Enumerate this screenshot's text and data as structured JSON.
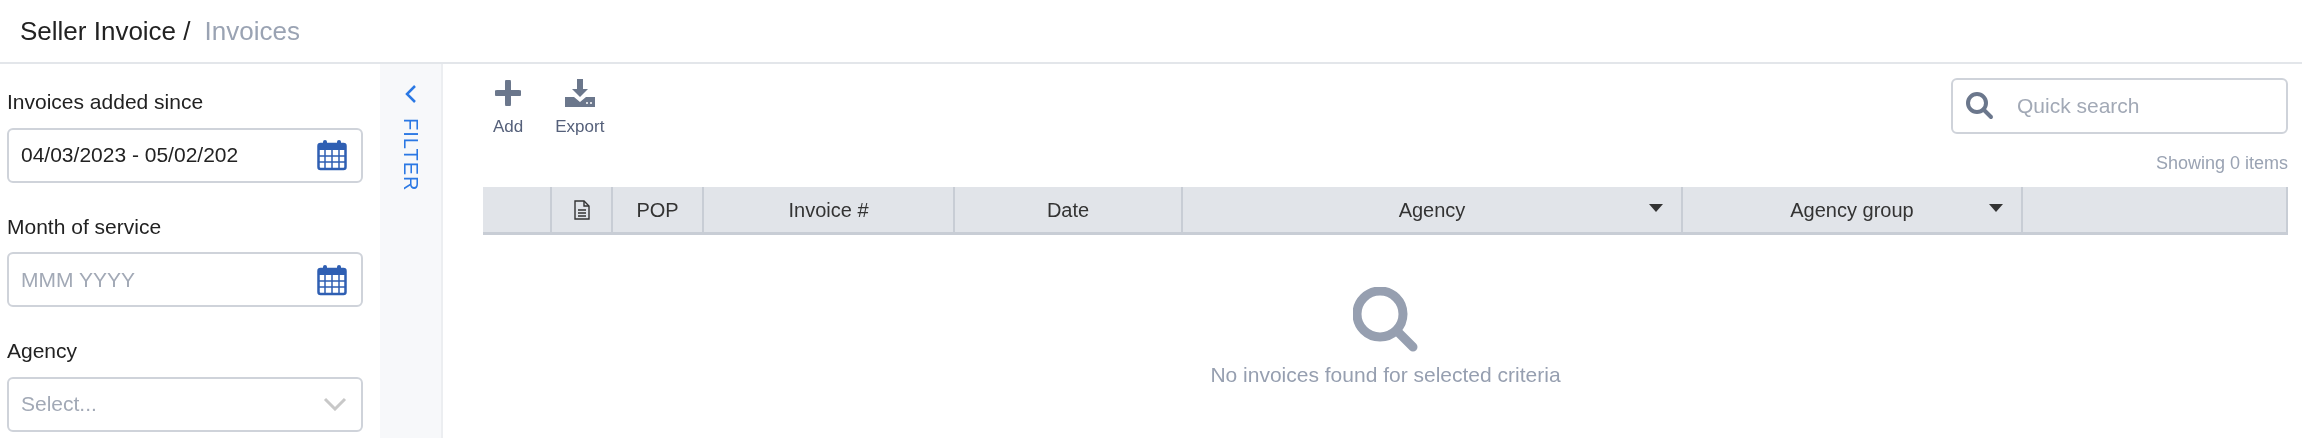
{
  "breadcrumb": [
    {
      "label": "Seller Invoice /",
      "current": false
    },
    {
      "label": "Invoices",
      "current": true
    }
  ],
  "filters": [
    {
      "kind": "date",
      "label": "Invoices added since",
      "value": "04/03/2023 - 05/02/202"
    },
    {
      "kind": "date",
      "label": "Month of service",
      "placeholder": "MMM YYYY"
    },
    {
      "kind": "select",
      "label": "Agency",
      "placeholder": "Select..."
    }
  ],
  "filter_toggle": {
    "label": "FILTER"
  },
  "toolbar": [
    {
      "kind": "add",
      "label": "Add"
    },
    {
      "kind": "export",
      "label": "Export"
    }
  ],
  "search": {
    "placeholder": "Quick search"
  },
  "item_count": "Showing 0 items",
  "table": {
    "columns": [
      {
        "kind": "blank"
      },
      {
        "kind": "document-icon"
      },
      {
        "kind": "text",
        "label": "POP"
      },
      {
        "kind": "text",
        "label": "Invoice #"
      },
      {
        "kind": "text",
        "label": "Date"
      },
      {
        "kind": "text",
        "label": "Agency",
        "dropdown": true
      },
      {
        "kind": "text",
        "label": "Agency group",
        "dropdown": true
      },
      {
        "kind": "blank"
      }
    ]
  },
  "empty_state": {
    "message": "No invoices found for selected criteria"
  }
}
